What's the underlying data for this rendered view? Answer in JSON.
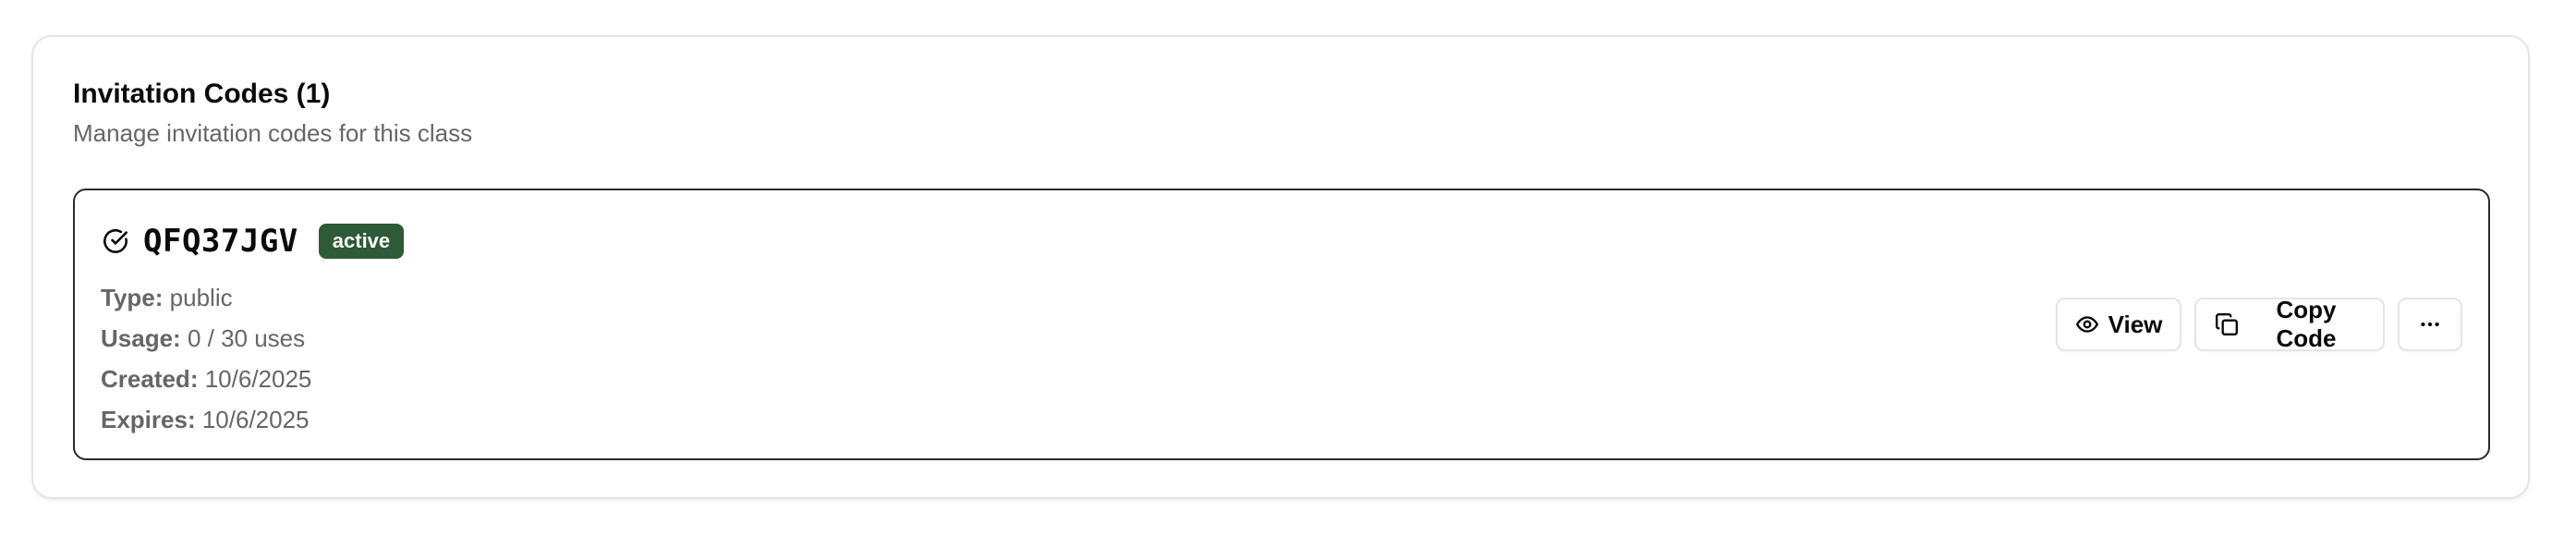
{
  "card": {
    "title": "Invitation Codes (1)",
    "subtitle": "Manage invitation codes for this class"
  },
  "codes": [
    {
      "code": "QFQ37JGV",
      "status": "active",
      "status_icon": "circle-check-icon",
      "details": [
        {
          "label": "Type:",
          "value": "public"
        },
        {
          "label": "Usage:",
          "value": "0 / 30 uses"
        },
        {
          "label": "Created:",
          "value": "10/6/2025"
        },
        {
          "label": "Expires:",
          "value": "10/6/2025"
        }
      ],
      "actions": {
        "view_label": "View",
        "view_icon": "eye-icon",
        "copy_label": "Copy Code",
        "copy_icon": "copy-icon",
        "more_icon": "ellipsis-icon"
      }
    }
  ],
  "colors": {
    "badge_background": "#2d5a37",
    "badge_text": "#ffffff",
    "muted_text": "#666666",
    "border": "#e5e5e5",
    "item_border": "#2b2b2b"
  }
}
